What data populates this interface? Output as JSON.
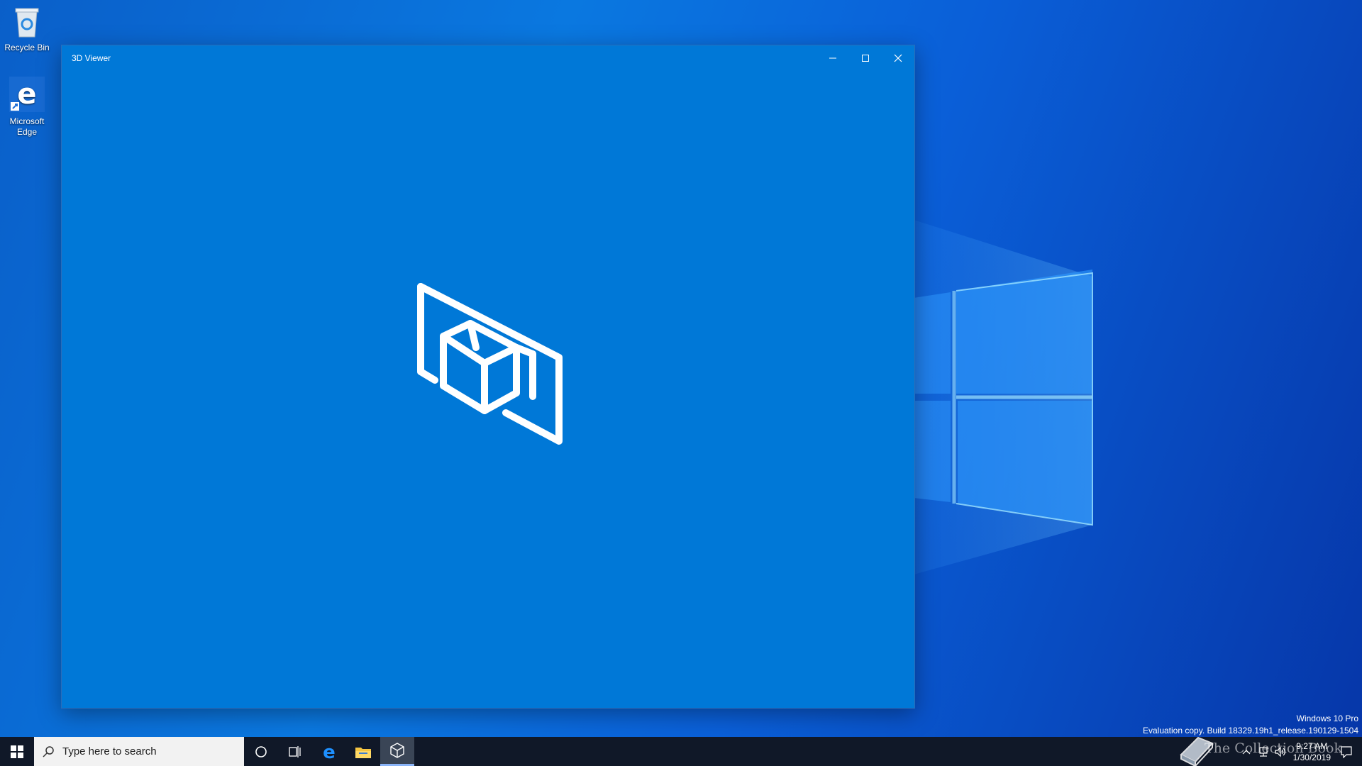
{
  "desktop": {
    "icons": [
      {
        "label": "Recycle Bin",
        "icon": "recycle-bin-icon"
      },
      {
        "label": "Microsoft Edge",
        "icon": "edge-icon"
      }
    ]
  },
  "window": {
    "title": "3D Viewer",
    "buttons": [
      "minimize",
      "maximize",
      "close"
    ],
    "background_color": "#0078d7",
    "splash_icon": "3d-viewer-logo-icon"
  },
  "taskbar": {
    "search_placeholder": "Type here to search",
    "pinned": [
      "cortana-icon",
      "task-view-icon",
      "edge-icon",
      "file-explorer-icon",
      "3d-viewer-icon"
    ],
    "active_app": "3D Viewer"
  },
  "watermark": {
    "line1": "Windows 10 Pro",
    "line2": "Evaluation copy. Build 18329.19h1_release.190129-1504"
  },
  "overlay_brand": "The Collection Book",
  "tray": {
    "time": "9:27 AM",
    "date": "1/30/2019"
  }
}
